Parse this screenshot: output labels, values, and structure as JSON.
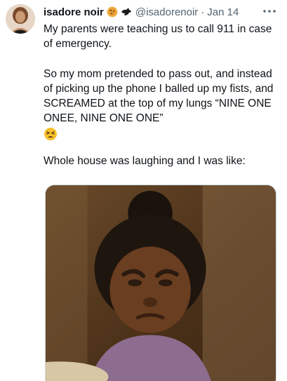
{
  "tweet": {
    "author": {
      "display_name": "isadore noir",
      "handle": "@isadorenoir",
      "badge_icons": [
        "cookie-emoji-icon",
        "bird-icon"
      ]
    },
    "separator": "·",
    "date": "Jan 14",
    "text": {
      "paragraph1": "My parents were teaching us to call 911 in case of emergency.",
      "paragraph2": "So my mom pretended to pass out, and instead of picking up the phone I balled up my fists, and SCREAMED at the top of my lungs “NINE ONE ONEE, NINE ONE ONE”",
      "paragraph2_emoji": "tired-face-emoji",
      "paragraph3": "Whole house was laughing and I was like:"
    },
    "media": {
      "type": "image",
      "icon": "photo-child-frowning"
    }
  },
  "colors": {
    "text_primary": "#0f1419",
    "text_secondary": "#536471",
    "border": "#cfd9de"
  }
}
